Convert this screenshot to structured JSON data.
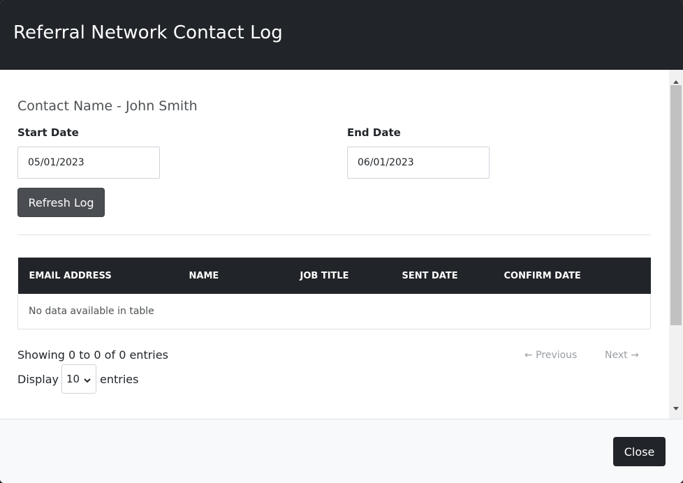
{
  "modal": {
    "title": "Referral Network Contact Log"
  },
  "form": {
    "contact_name": "Contact Name - John Smith",
    "start_date_label": "Start Date",
    "start_date_value": "05/01/2023",
    "end_date_label": "End Date",
    "end_date_value": "06/01/2023",
    "refresh_label": "Refresh Log"
  },
  "table": {
    "columns": [
      "EMAIL ADDRESS",
      "NAME",
      "JOB TITLE",
      "SENT DATE",
      "CONFIRM DATE"
    ],
    "empty_message": "No data available in table"
  },
  "pagination": {
    "info": "Showing 0 to 0 of 0 entries",
    "display_label": "Display",
    "page_length": "10",
    "entries_label": "entries",
    "previous_label": "← Previous",
    "next_label": "Next →"
  },
  "footer": {
    "close_label": "Close"
  }
}
